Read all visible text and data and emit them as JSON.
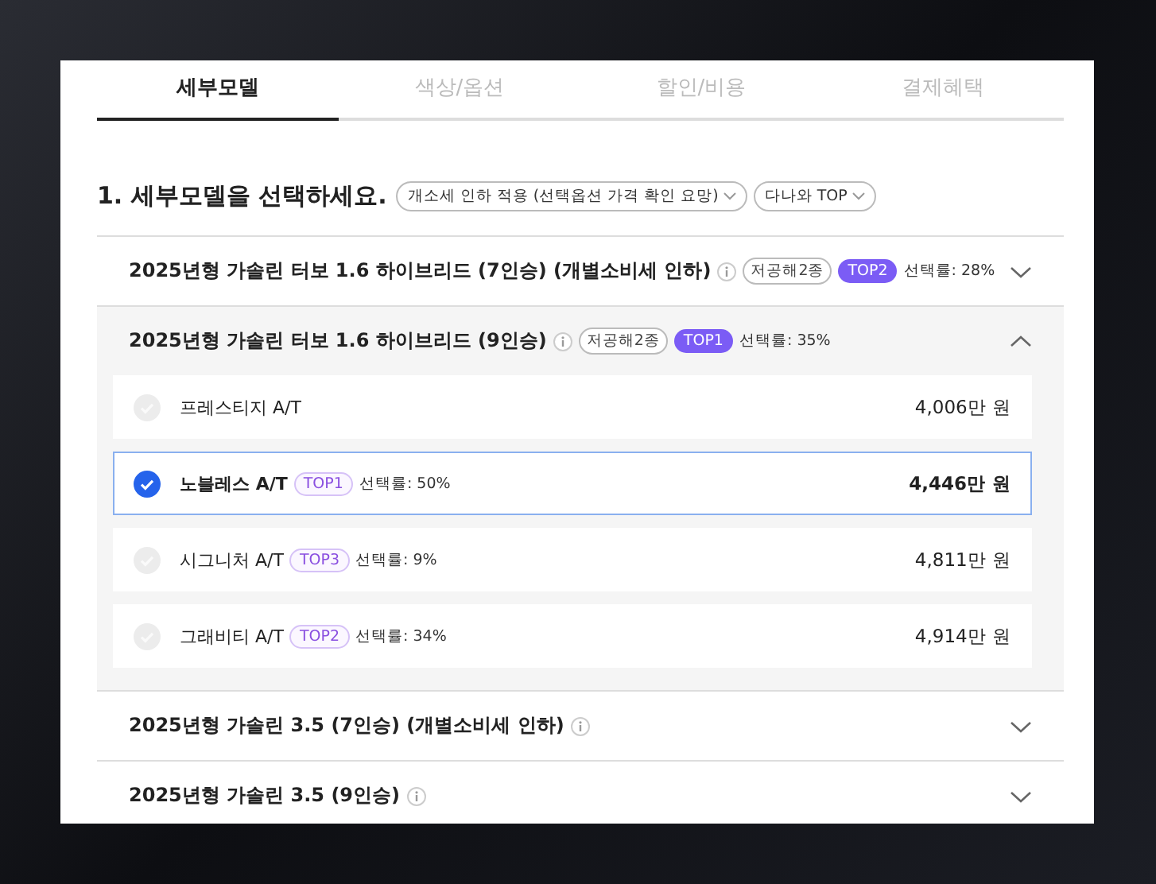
{
  "tabs": [
    {
      "label": "세부모델",
      "selected": true
    },
    {
      "label": "색상/옵션",
      "selected": false
    },
    {
      "label": "할인/비용",
      "selected": false
    },
    {
      "label": "결제혜택",
      "selected": false
    }
  ],
  "heading": "1. 세부모델을 선택하세요.",
  "filters": [
    {
      "label": "개소세 인하 적용 (선택옵션 가격 확인 요망)"
    },
    {
      "label": "다나와 TOP"
    }
  ],
  "models": [
    {
      "name": "2025년형 가솔린 터보 1.6 하이브리드 (7인승) (개별소비세 인하)",
      "eco": "저공해2종",
      "rank": "TOP2",
      "rate": "선택률: 28%",
      "expanded": false
    },
    {
      "name": "2025년형 가솔린 터보 1.6 하이브리드 (9인승)",
      "eco": "저공해2종",
      "rank": "TOP1",
      "rate": "선택률: 35%",
      "expanded": true,
      "trims": [
        {
          "name": "프레스티지 A/T",
          "price": "4,006만 원",
          "selected": false
        },
        {
          "name": "노블레스 A/T",
          "rank": "TOP1",
          "rate": "선택률: 50%",
          "price": "4,446만 원",
          "selected": true
        },
        {
          "name": "시그니처 A/T",
          "rank": "TOP3",
          "rate": "선택률: 9%",
          "price": "4,811만 원",
          "selected": false
        },
        {
          "name": "그래비티 A/T",
          "rank": "TOP2",
          "rate": "선택률: 34%",
          "price": "4,914만 원",
          "selected": false
        }
      ]
    },
    {
      "name": "2025년형 가솔린 3.5 (7인승) (개별소비세 인하)",
      "expanded": false
    },
    {
      "name": "2025년형 가솔린 3.5 (9인승)",
      "expanded": false
    }
  ]
}
